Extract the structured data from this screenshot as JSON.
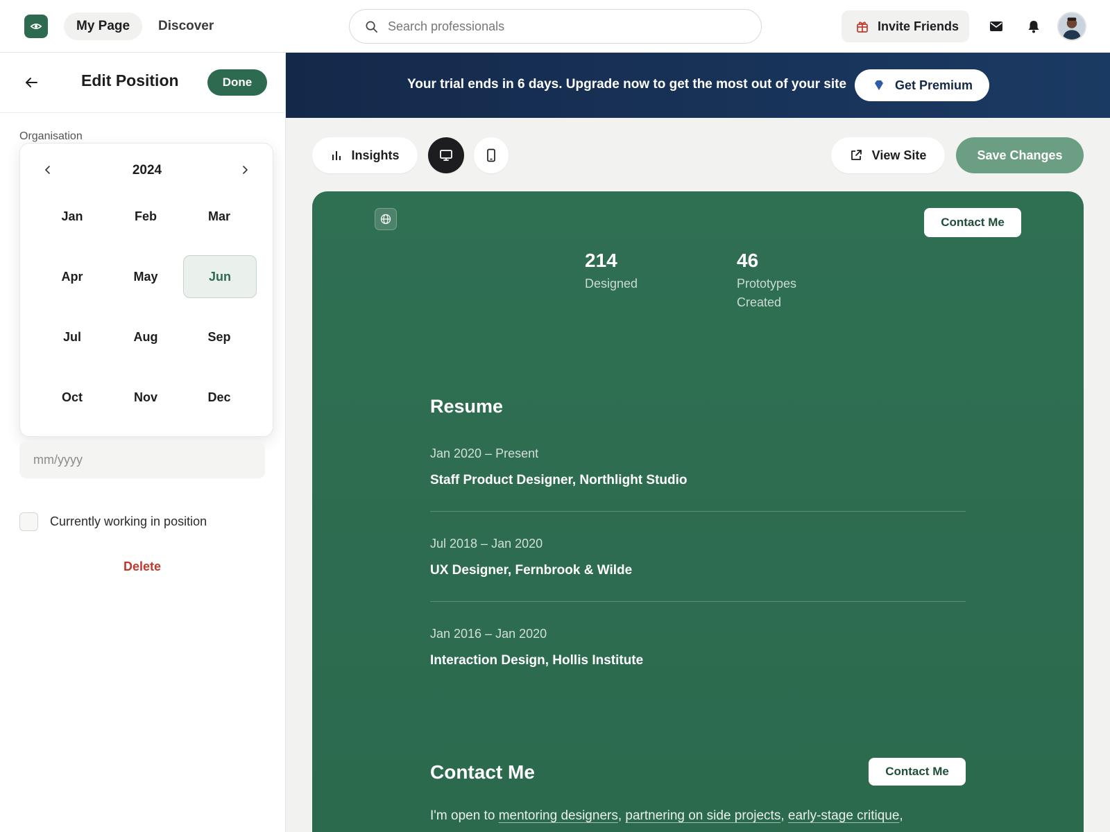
{
  "topnav": {
    "my_page": "My Page",
    "discover": "Discover",
    "search_placeholder": "Search professionals",
    "invite_label": "Invite Friends",
    "icons": {
      "logo": "eye-logo-icon",
      "search": "search-icon",
      "invite": "gift-icon",
      "mail": "mail-icon",
      "bell": "bell-icon"
    }
  },
  "edit_panel": {
    "title": "Edit Position",
    "done_label": "Done",
    "organisation_label": "Organisation",
    "calendar": {
      "year": "2024",
      "months": [
        "Jan",
        "Feb",
        "Mar",
        "Apr",
        "May",
        "Jun",
        "Jul",
        "Aug",
        "Sep",
        "Oct",
        "Nov",
        "Dec"
      ],
      "selected_month": "Jun"
    },
    "date_placeholder": "mm/yyyy",
    "currently_working_label": "Currently working in position",
    "currently_working_checked": false,
    "delete_label": "Delete"
  },
  "banner": {
    "text": "Your trial ends in 6 days. Upgrade now to get the most out of your site",
    "premium_label": "Get Premium"
  },
  "toolbar": {
    "insights_label": "Insights",
    "view_site_label": "View Site",
    "save_label": "Save Changes",
    "active_view": "desktop"
  },
  "preview": {
    "contact_button": "Contact Me",
    "stats": [
      {
        "value": "214",
        "label": "Designed"
      },
      {
        "value": "46",
        "label": "Prototypes Created"
      }
    ],
    "resume_title": "Resume",
    "resume": [
      {
        "dates": "Jan 2020 – Present",
        "role": "Staff Product Designer, Northlight Studio"
      },
      {
        "dates": "Jul 2018 – Jan 2020",
        "role": "UX Designer, Fernbrook & Wilde"
      },
      {
        "dates": "Jan 2016 – Jan 2020",
        "role": "Interaction Design, Hollis Institute"
      }
    ],
    "contact_title": "Contact Me",
    "contact_button_2": "Contact Me",
    "contact_text": {
      "intro": "I'm open to ",
      "link1": "mentoring designers",
      "sep1": ", ",
      "link2": "partnering on side projects",
      "sep2": ", ",
      "link3": "early-stage critique",
      "end": ","
    }
  },
  "colors": {
    "brand_green": "#2d6a4f",
    "banner_navy": "#14294a",
    "delete_red": "#c0392b",
    "save_green": "#6b9e82"
  }
}
